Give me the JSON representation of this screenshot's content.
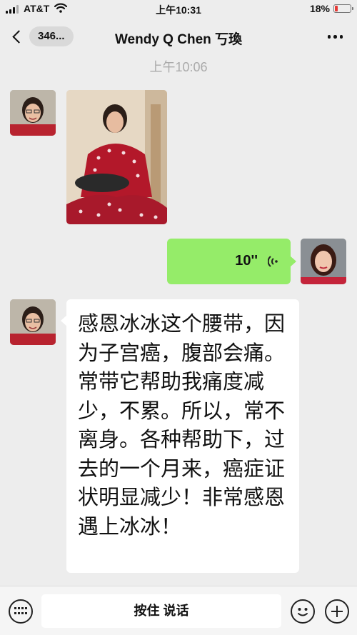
{
  "status_bar": {
    "carrier": "AT&T",
    "time": "上午10:31",
    "battery_percent": "18%",
    "battery_level": 0.18,
    "signal_icon": "signal-bars-icon",
    "wifi_icon": "wifi-icon",
    "battery_icon": "battery-low-icon"
  },
  "nav": {
    "back_count": "346...",
    "back_icon": "chevron-left-icon",
    "title": "Wendy Q Chen 丂瑍",
    "more_icon": "more-dots-icon"
  },
  "chat": {
    "timestamp": "上午10:06",
    "voice_message": {
      "duration": "10''",
      "icon": "voice-wave-icon",
      "bubble_color": "#95ec69"
    },
    "text_message": "感恩冰冰这个腰带，因为子宫癌，腹部会痛。常带它帮助我痛度减少，不累。所以，常不离身。各种帮助下，过去的一个月来，癌症证状明显减少！非常感恩遇上冰冰！"
  },
  "input_bar": {
    "keyboard_icon": "keyboard-icon",
    "hold_to_talk": "按住 说话",
    "emoji_icon": "emoji-icon",
    "plus_icon": "plus-icon"
  }
}
